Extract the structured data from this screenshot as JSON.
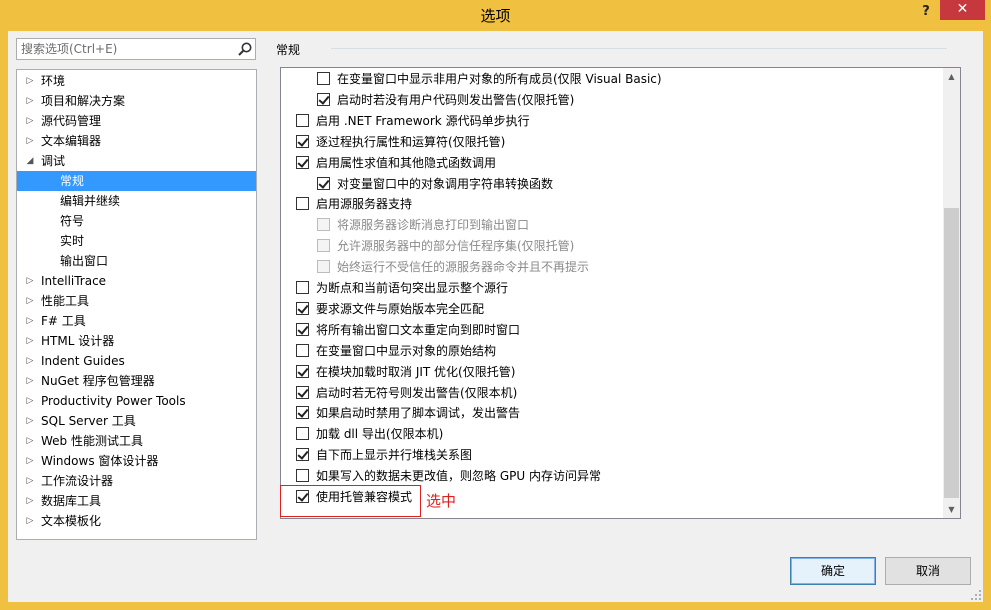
{
  "window": {
    "title": "选项",
    "help_label": "?",
    "close_label": "✕"
  },
  "search": {
    "placeholder": "搜索选项(Ctrl+E)"
  },
  "tree": {
    "items": [
      {
        "label": "环境",
        "arrow": "▷",
        "level": 0
      },
      {
        "label": "项目和解决方案",
        "arrow": "▷",
        "level": 0
      },
      {
        "label": "源代码管理",
        "arrow": "▷",
        "level": 0
      },
      {
        "label": "文本编辑器",
        "arrow": "▷",
        "level": 0
      },
      {
        "label": "调试",
        "arrow": "◢",
        "level": 0
      },
      {
        "label": "常规",
        "arrow": "",
        "level": 1,
        "selected": true
      },
      {
        "label": "编辑并继续",
        "arrow": "",
        "level": 1
      },
      {
        "label": "符号",
        "arrow": "",
        "level": 1
      },
      {
        "label": "实时",
        "arrow": "",
        "level": 1
      },
      {
        "label": "输出窗口",
        "arrow": "",
        "level": 1
      },
      {
        "label": "IntelliTrace",
        "arrow": "▷",
        "level": 0
      },
      {
        "label": "性能工具",
        "arrow": "▷",
        "level": 0
      },
      {
        "label": "F# 工具",
        "arrow": "▷",
        "level": 0
      },
      {
        "label": "HTML 设计器",
        "arrow": "▷",
        "level": 0
      },
      {
        "label": "Indent Guides",
        "arrow": "▷",
        "level": 0
      },
      {
        "label": "NuGet 程序包管理器",
        "arrow": "▷",
        "level": 0
      },
      {
        "label": "Productivity Power Tools",
        "arrow": "▷",
        "level": 0
      },
      {
        "label": "SQL Server 工具",
        "arrow": "▷",
        "level": 0
      },
      {
        "label": "Web 性能测试工具",
        "arrow": "▷",
        "level": 0
      },
      {
        "label": "Windows 窗体设计器",
        "arrow": "▷",
        "level": 0
      },
      {
        "label": "工作流设计器",
        "arrow": "▷",
        "level": 0
      },
      {
        "label": "数据库工具",
        "arrow": "▷",
        "level": 0
      },
      {
        "label": "文本模板化",
        "arrow": "▷",
        "level": 0
      }
    ]
  },
  "main": {
    "section_title": "常规",
    "options": [
      {
        "label": "在变量窗口中显示非用户对象的所有成员(仅限 Visual Basic)",
        "checked": false,
        "indent": 1,
        "disabled": false
      },
      {
        "label": "启动时若没有用户代码则发出警告(仅限托管)",
        "checked": true,
        "indent": 1,
        "disabled": false
      },
      {
        "label": "启用 .NET Framework 源代码单步执行",
        "checked": false,
        "indent": 0,
        "disabled": false
      },
      {
        "label": "逐过程执行属性和运算符(仅限托管)",
        "checked": true,
        "indent": 0,
        "disabled": false
      },
      {
        "label": "启用属性求值和其他隐式函数调用",
        "checked": true,
        "indent": 0,
        "disabled": false
      },
      {
        "label": "对变量窗口中的对象调用字符串转换函数",
        "checked": true,
        "indent": 1,
        "disabled": false
      },
      {
        "label": "启用源服务器支持",
        "checked": false,
        "indent": 0,
        "disabled": false
      },
      {
        "label": "将源服务器诊断消息打印到输出窗口",
        "checked": false,
        "indent": 1,
        "disabled": true
      },
      {
        "label": "允许源服务器中的部分信任程序集(仅限托管)",
        "checked": false,
        "indent": 1,
        "disabled": true
      },
      {
        "label": "始终运行不受信任的源服务器命令并且不再提示",
        "checked": false,
        "indent": 1,
        "disabled": true
      },
      {
        "label": "为断点和当前语句突出显示整个源行",
        "checked": false,
        "indent": 0,
        "disabled": false
      },
      {
        "label": "要求源文件与原始版本完全匹配",
        "checked": true,
        "indent": 0,
        "disabled": false
      },
      {
        "label": "将所有输出窗口文本重定向到即时窗口",
        "checked": true,
        "indent": 0,
        "disabled": false
      },
      {
        "label": "在变量窗口中显示对象的原始结构",
        "checked": false,
        "indent": 0,
        "disabled": false
      },
      {
        "label": "在模块加载时取消 JIT 优化(仅限托管)",
        "checked": true,
        "indent": 0,
        "disabled": false
      },
      {
        "label": "启动时若无符号则发出警告(仅限本机)",
        "checked": true,
        "indent": 0,
        "disabled": false
      },
      {
        "label": "如果启动时禁用了脚本调试，发出警告",
        "checked": true,
        "indent": 0,
        "disabled": false
      },
      {
        "label": "加载 dll 导出(仅限本机)",
        "checked": false,
        "indent": 0,
        "disabled": false
      },
      {
        "label": "自下而上显示并行堆栈关系图",
        "checked": true,
        "indent": 0,
        "disabled": false
      },
      {
        "label": "如果写入的数据未更改值，则忽略 GPU 内存访问异常",
        "checked": false,
        "indent": 0,
        "disabled": false
      },
      {
        "label": "使用托管兼容模式",
        "checked": true,
        "indent": 0,
        "disabled": false
      }
    ],
    "annotation": "选中"
  },
  "footer": {
    "ok_label": "确定",
    "cancel_label": "取消"
  },
  "colors": {
    "titlebar": "#f0c040",
    "close": "#c7373e",
    "selection": "#3399ff",
    "annotation": "#e02020"
  }
}
